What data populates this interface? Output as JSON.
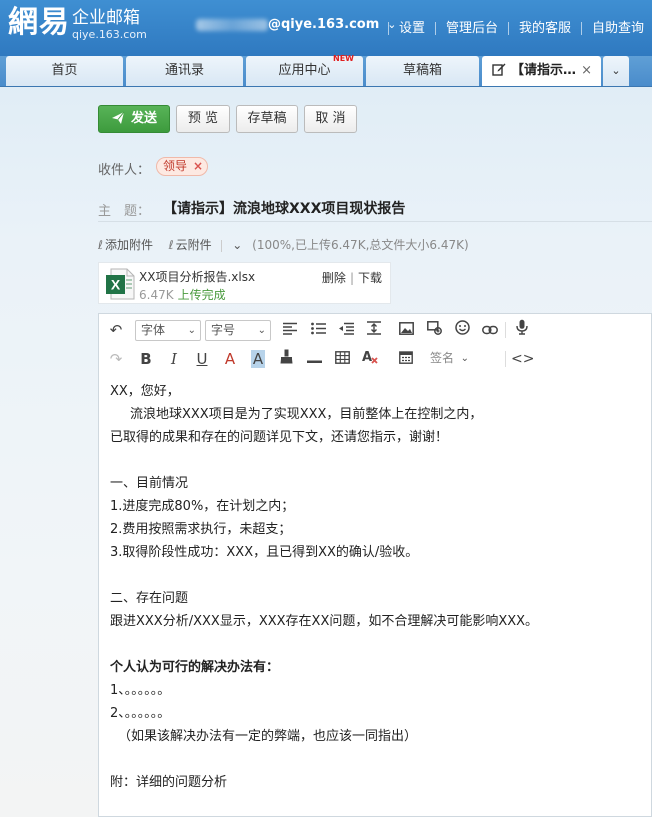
{
  "brand": {
    "logo": "網易",
    "title": "企业邮箱",
    "sub": "qiye.163.com"
  },
  "account": {
    "domain": "@qiye.163.com"
  },
  "toplinks": [
    "设置",
    "管理后台",
    "我的客服",
    "自助查询"
  ],
  "tabs": [
    {
      "label": "首页"
    },
    {
      "label": "通讯录"
    },
    {
      "label": "应用中心",
      "badge": "NEW"
    },
    {
      "label": "草稿箱"
    },
    {
      "label": "【请指示…"
    }
  ],
  "actions": {
    "send": "发送",
    "preview": "预 览",
    "draft": "存草稿",
    "cancel": "取 消"
  },
  "recipient": {
    "label": "收件人：",
    "value": "领导"
  },
  "subject": {
    "label": "主　题：",
    "value": "【请指示】流浪地球XXX项目现状报告"
  },
  "attach": {
    "add": "添加附件",
    "cloud": "云附件",
    "info": "(100%,已上传6.47K,总文件大小6.47K)"
  },
  "file": {
    "name": "XX项目分析报告.xlsx",
    "size": "6.47K",
    "status": "上传完成",
    "delete": "删除",
    "download": "下载"
  },
  "toolbar": {
    "font": "字体",
    "size": "字号",
    "signature": "签名"
  },
  "body": [
    "XX，您好，",
    "流浪地球XXX项目是为了实现XXX，目前整体上在控制之内，",
    "已取得的成果和存在的问题详见下文，还请您指示，谢谢！",
    "",
    "一、目前情况",
    "1.进度完成80%，在计划之内；",
    "2.费用按照需求执行，未超支；",
    "3.取得阶段性成功：XXX，且已得到XX的确认/验收。",
    "",
    "二、存在问题",
    "跟进XXX分析/XXX显示，XXX存在XX问题，如不合理解决可能影响XXX。",
    "",
    "个人认为可行的解决办法有：",
    "1、。。。。。。",
    "2、。。。。。。",
    "（如果该解决办法有一定的弊端，也应该一同指出）",
    "",
    "附：详细的问题分析"
  ],
  "colors": {
    "topbar": "#2f79c0",
    "send": "#3d9b3d",
    "accent_red": "#d9534f"
  }
}
